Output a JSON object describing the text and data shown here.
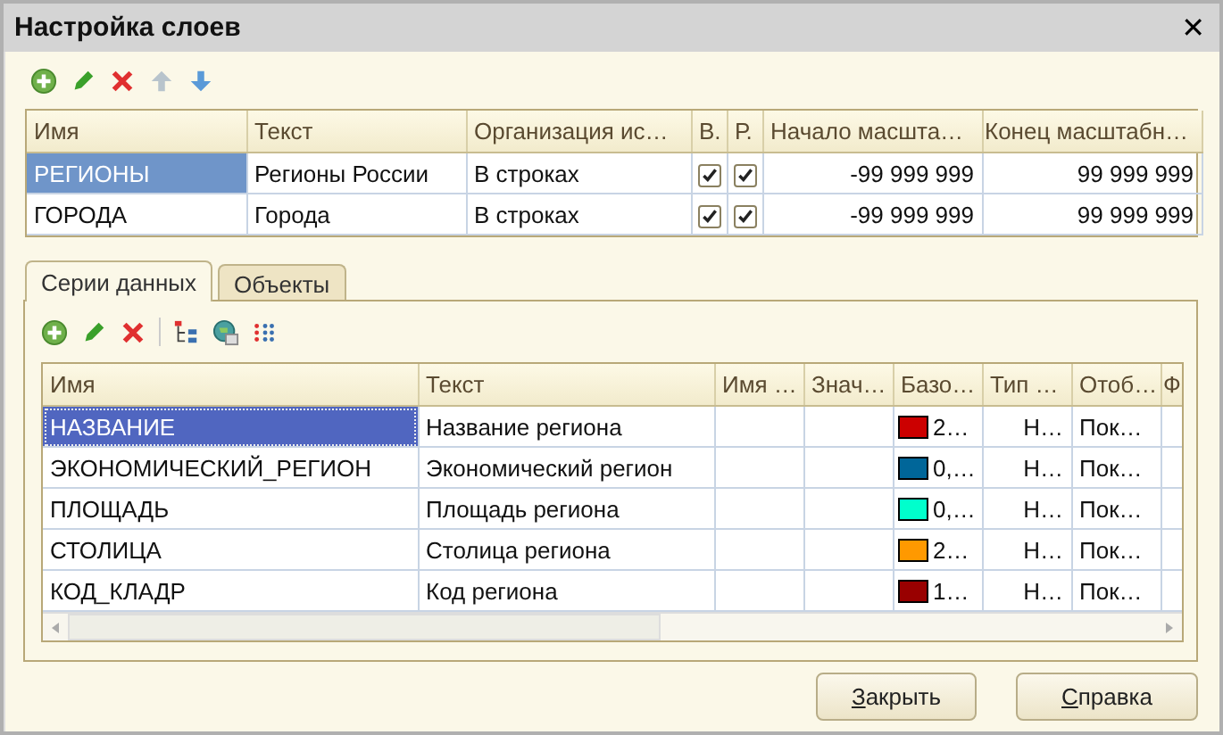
{
  "window": {
    "title": "Настройка слоев",
    "close": "✕"
  },
  "layers": {
    "columns": [
      "Имя",
      "Текст",
      "Организация ис…",
      "В.",
      "Р.",
      "Начало масшта…",
      "Конец масштабн…"
    ],
    "rows": [
      {
        "name": "РЕГИОНЫ",
        "text": "Регионы России",
        "organization": "В строках",
        "check_v": true,
        "check_r": true,
        "scale_start": "-99 999 999",
        "scale_end": "99 999 999",
        "selected": true
      },
      {
        "name": "ГОРОДА",
        "text": "Города",
        "organization": "В строках",
        "check_v": true,
        "check_r": true,
        "scale_start": "-99 999 999",
        "scale_end": "99 999 999",
        "selected": false
      }
    ]
  },
  "tabs": [
    {
      "label": "Серии данных",
      "selected": true
    },
    {
      "label": "Объекты",
      "selected": false
    }
  ],
  "series": {
    "columns": [
      "Имя",
      "Текст",
      "Имя …",
      "Знач…",
      "Базо…",
      "Тип …",
      "Отоб…",
      "Ф"
    ],
    "rows": [
      {
        "name": "НАЗВАНИЕ",
        "text": "Название региона",
        "color": "#cc0000",
        "base": "2…",
        "type": "Н…",
        "display": "Пок…",
        "selected": true
      },
      {
        "name": "ЭКОНОМИЧЕСКИЙ_РЕГИОН",
        "text": "Экономический регион",
        "color": "#006699",
        "base": "0,…",
        "type": "Н…",
        "display": "Пок…",
        "selected": false
      },
      {
        "name": "ПЛОЩАДЬ",
        "text": "Площадь региона",
        "color": "#00ffcc",
        "base": "0,…",
        "type": "Н…",
        "display": "Пок…",
        "selected": false
      },
      {
        "name": "СТОЛИЦА",
        "text": "Столица региона",
        "color": "#ff9900",
        "base": "2…",
        "type": "Н…",
        "display": "Пок…",
        "selected": false
      },
      {
        "name": "КОД_КЛАДР",
        "text": "Код региона",
        "color": "#990000",
        "base": "1…",
        "type": "Н…",
        "display": "Пок…",
        "selected": false
      }
    ]
  },
  "buttons": [
    {
      "label": "Закрыть"
    },
    {
      "label": "Справка"
    }
  ]
}
